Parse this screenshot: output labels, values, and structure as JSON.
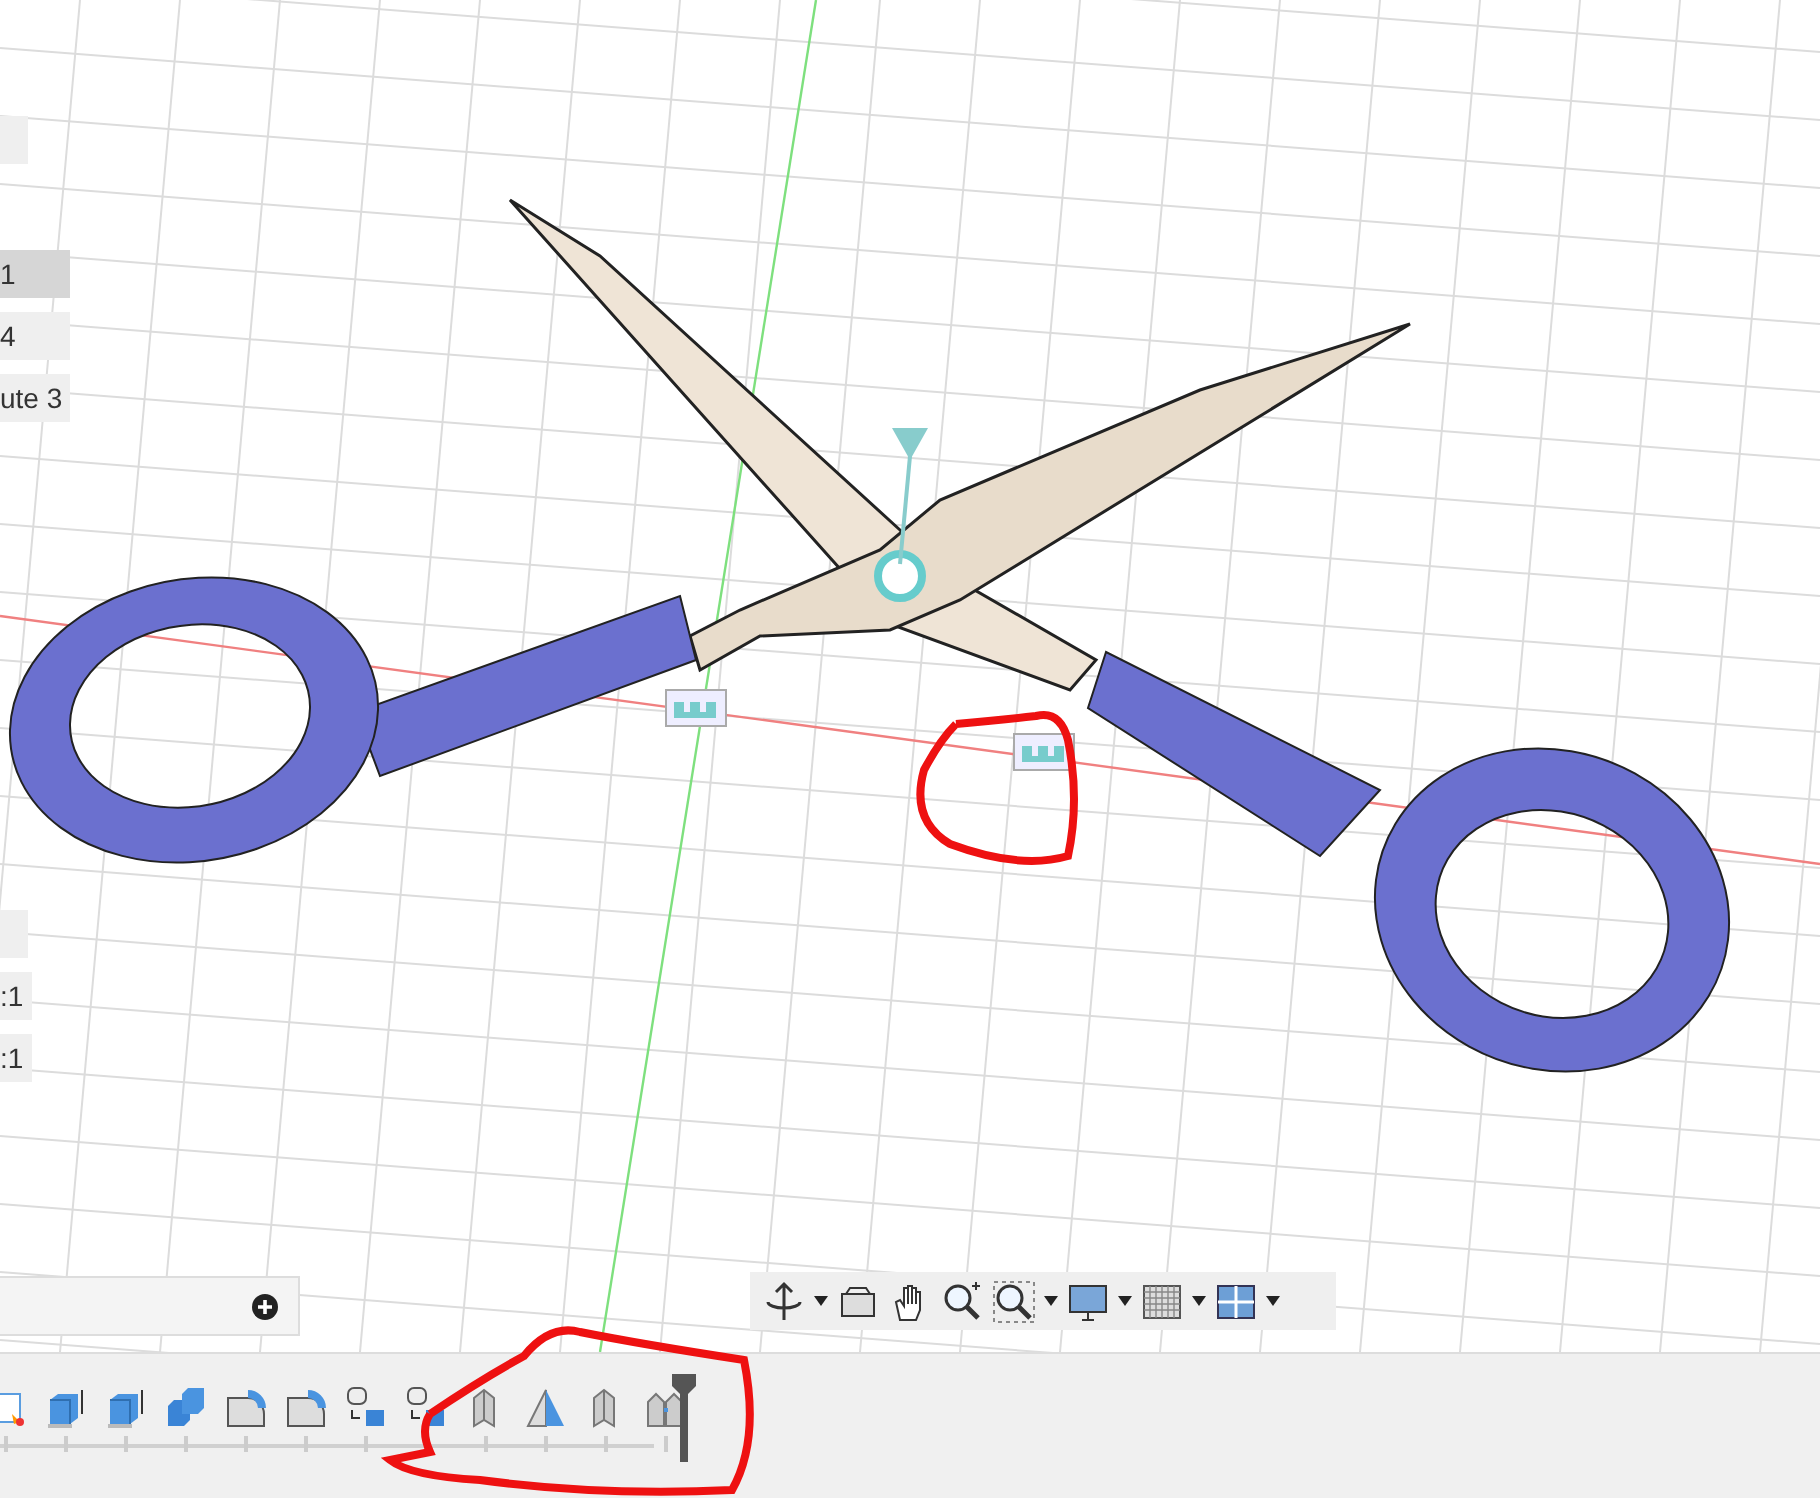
{
  "browser_labels": [
    {
      "text": "1",
      "selected": true
    },
    {
      "text": "4",
      "selected": false
    },
    {
      "text": "ute 3",
      "selected": false
    }
  ],
  "lower_labels": [
    {
      "text": ":1"
    },
    {
      "text": ":1"
    }
  ],
  "timeline": {
    "features": [
      {
        "kind": "sketch"
      },
      {
        "kind": "extrude"
      },
      {
        "kind": "extrude"
      },
      {
        "kind": "combine"
      },
      {
        "kind": "fillet"
      },
      {
        "kind": "fillet"
      },
      {
        "kind": "copy"
      },
      {
        "kind": "copy"
      },
      {
        "kind": "joint"
      },
      {
        "kind": "mirror"
      },
      {
        "kind": "joint"
      },
      {
        "kind": "joint-pair"
      }
    ]
  }
}
